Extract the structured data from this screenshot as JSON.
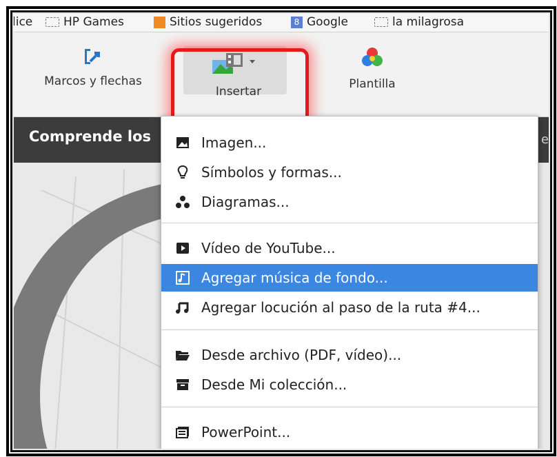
{
  "bookmarks": [
    {
      "label": "lice",
      "icon": "none"
    },
    {
      "label": "HP Games",
      "icon": "folder-icon"
    },
    {
      "label": "Sitios sugeridos",
      "icon": "orange-square-icon"
    },
    {
      "label": "Google",
      "icon": "google-icon"
    },
    {
      "label": "la milagrosa",
      "icon": "folder-icon"
    }
  ],
  "toolbar": {
    "marcos_label": "Marcos y flechas",
    "insertar_label": "Insertar",
    "plantilla_label": "Plantilla"
  },
  "title": {
    "text": "Comprende los",
    "right": "e"
  },
  "menu": {
    "groups": [
      [
        {
          "label": "Imagen...",
          "icon": "image-icon"
        },
        {
          "label": "Símbolos y formas...",
          "icon": "bulb-icon"
        },
        {
          "label": "Diagramas...",
          "icon": "diagram-icon"
        }
      ],
      [
        {
          "label": "Vídeo de YouTube...",
          "icon": "play-icon"
        },
        {
          "label": "Agregar música de fondo...",
          "icon": "music-note-icon",
          "active": true
        },
        {
          "label": "Agregar locución al paso de la ruta #4...",
          "icon": "music-notes-icon"
        }
      ],
      [
        {
          "label": "Desde archivo (PDF, vídeo)...",
          "icon": "folder-open-icon"
        },
        {
          "label": "Desde Mi colección...",
          "icon": "archive-box-icon"
        }
      ],
      [
        {
          "label": "PowerPoint...",
          "icon": "powerpoint-icon"
        }
      ]
    ]
  },
  "colors": {
    "highlight": "#e41b1b",
    "active_row": "#3a86e0",
    "titlebar": "#3c3c3c"
  }
}
